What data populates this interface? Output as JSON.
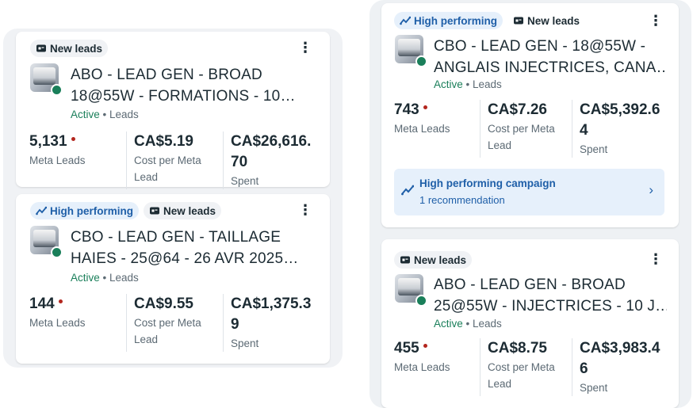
{
  "colors": {
    "accent_blue": "#1f5fa8",
    "active_green": "#1a7f5a",
    "dot_red": "#b3261e",
    "muted_text": "#5c6a74"
  },
  "cards": [
    {
      "badges": [
        "New leads"
      ],
      "title_line1": "ABO - LEAD GEN - BROAD",
      "title_line2": "18@55W - FORMATIONS - 10…",
      "status": "Active",
      "objective": "Leads",
      "results_value": "5,131",
      "results_label": "Meta Leads",
      "cpr_value": "CA$5.19",
      "cpr_label1": "Cost per Meta",
      "cpr_label2": "Lead",
      "spent_line1": "CA$26,616.",
      "spent_line2": "70",
      "spent_label": "Spent"
    },
    {
      "badges": [
        "High performing",
        "New leads"
      ],
      "title_line1": "CBO - LEAD GEN - TAILLAGE",
      "title_line2": "HAIES - 25@64 - 26 AVR 2025…",
      "status": "Active",
      "objective": "Leads",
      "results_value": "144",
      "results_label": "Meta Leads",
      "cpr_value": "CA$9.55",
      "cpr_label1": "Cost per Meta",
      "cpr_label2": "Lead",
      "spent_line1": "CA$1,375.3",
      "spent_line2": "9",
      "spent_label": "Spent"
    },
    {
      "badges": [
        "High performing",
        "New leads"
      ],
      "title_line1": "CBO - LEAD GEN - 18@55W -",
      "title_line2": "ANGLAIS INJECTRICES, CANA…",
      "status": "Active",
      "objective": "Leads",
      "results_value": "743",
      "results_label": "Meta Leads",
      "cpr_value": "CA$7.26",
      "cpr_label1": "Cost per Meta",
      "cpr_label2": "Lead",
      "spent_line1": "CA$5,392.6",
      "spent_line2": "4",
      "spent_label": "Spent",
      "recommendation_title": "High performing campaign",
      "recommendation_sub": "1 recommendation"
    },
    {
      "badges": [
        "New leads"
      ],
      "title_line1": "ABO - LEAD GEN - BROAD",
      "title_line2": "25@55W - INJECTRICES - 10 J…",
      "status": "Active",
      "objective": "Leads",
      "results_value": "455",
      "results_label": "Meta Leads",
      "cpr_value": "CA$8.75",
      "cpr_label1": "Cost per Meta",
      "cpr_label2": "Lead",
      "spent_line1": "CA$3,983.4",
      "spent_line2": "6",
      "spent_label": "Spent"
    }
  ],
  "icons": {
    "new_leads": "lead-form-icon",
    "high_performing": "trend-up-icon",
    "more": "more-vertical-icon",
    "chevron": "chevron-right-icon"
  }
}
